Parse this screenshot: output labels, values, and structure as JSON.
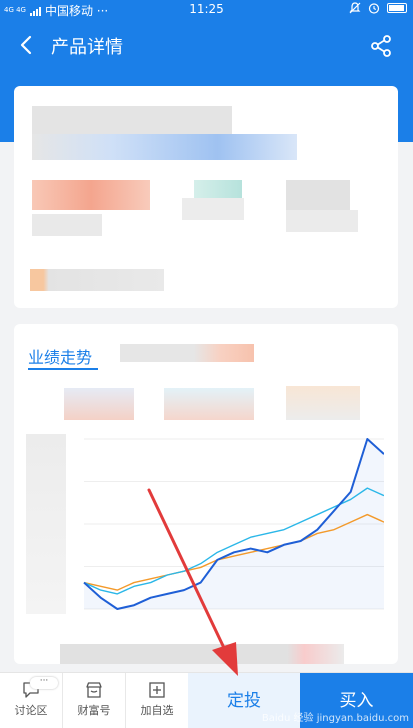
{
  "status_bar": {
    "network_type": "4G 4G",
    "carrier": "中国移动 ···",
    "time": "11:25"
  },
  "header": {
    "title": "产品详情"
  },
  "performance": {
    "tab_label": "业绩走势"
  },
  "chart_data": {
    "type": "line",
    "title": "",
    "xlabel": "",
    "ylabel": "",
    "series": [
      {
        "color": "#1f5fd6",
        "values": [
          0.0,
          -2.0,
          -3.5,
          -3.0,
          -2.0,
          -1.5,
          -1.0,
          0.0,
          3.0,
          4.0,
          4.5,
          4.0,
          5.0,
          5.5,
          7.0,
          9.5,
          12.0,
          19.0,
          17.0
        ]
      },
      {
        "color": "#2bb7e8",
        "values": [
          0.0,
          -1.0,
          -1.5,
          -0.5,
          0.0,
          1.0,
          1.5,
          2.5,
          4.0,
          5.0,
          6.0,
          6.5,
          7.0,
          8.0,
          9.0,
          10.0,
          11.0,
          12.5,
          11.5
        ]
      },
      {
        "color": "#f39a2b",
        "values": [
          0.0,
          -0.5,
          -1.0,
          0.0,
          0.5,
          1.0,
          1.5,
          2.0,
          3.0,
          3.5,
          4.0,
          4.5,
          5.0,
          5.5,
          6.5,
          7.0,
          8.0,
          9.0,
          8.0
        ]
      }
    ]
  },
  "bottom_bar": {
    "discuss_label": "讨论区",
    "caifu_label": "财富号",
    "add_watch_label": "加自选",
    "dingtou_label": "定投",
    "buy_label": "买入",
    "more_badge": "···"
  },
  "watermark": "Baidu 经验 jingyan.baidu.com"
}
